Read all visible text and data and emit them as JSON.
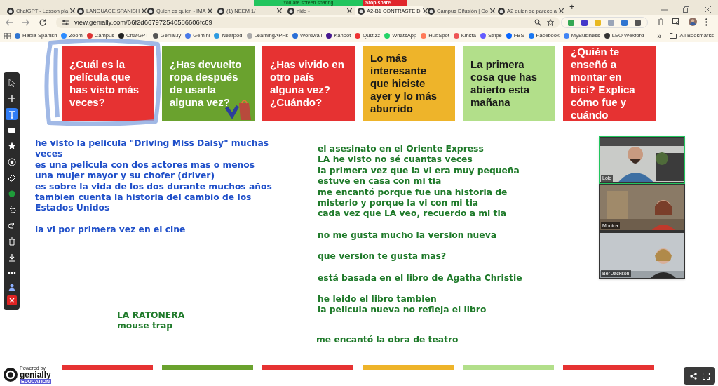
{
  "browser": {
    "tabs": [
      {
        "label": "ChatGPT - Lesson pla",
        "selected": false
      },
      {
        "label": "LANGUAGE SPANISH",
        "selected": false
      },
      {
        "label": "Quien es quien - IMA",
        "selected": false
      },
      {
        "label": "(1) NEEM 1/",
        "selected": false
      },
      {
        "label": "nido -",
        "selected": false
      },
      {
        "label": "A2-B1 CONTRASTE D",
        "selected": true
      },
      {
        "label": "Campus Difusión | Co",
        "selected": false
      },
      {
        "label": "A2 quien se parece a",
        "selected": false
      }
    ],
    "new_tab": "+",
    "sharing_banner": {
      "text": "You are screen sharing",
      "stop": "Stop share"
    },
    "url": "view.genially.com/66f2d667972540586606fc69",
    "bookmarks": [
      "Habla Spanish",
      "Zoom",
      "Campus",
      "ChatGPT",
      "Genial.ly",
      "Gemini",
      "Nearpod",
      "LearningAPPs",
      "Wordwall",
      "Kahoot",
      "Quizizz",
      "WhatsApp",
      "HubSpot",
      "Kinsta",
      "Stripe",
      "FBS",
      "Facebook",
      "MyBusiness",
      "LEO Wexford"
    ],
    "more_bookmarks": "»",
    "all_bookmarks": "All Bookmarks"
  },
  "slide": {
    "cards": [
      {
        "text": "¿Cuál es la película que has visto más veces?",
        "color": "#e63232",
        "dark_text": false
      },
      {
        "text": "¿Has devuelto ropa después de usarla alguna vez?",
        "color": "#6aa22e",
        "dark_text": false
      },
      {
        "text": "¿Has vivido en otro país alguna vez? ¿Cuándo?",
        "color": "#e63232",
        "dark_text": false
      },
      {
        "text": "Lo más interesante que hiciste ayer y lo más aburrido",
        "color": "#eeb42a",
        "dark_text": true
      },
      {
        "text": "La primera cosa que has abierto esta mañana",
        "color": "#b2df8a",
        "dark_text": true
      },
      {
        "text": "¿Quién te enseñó a montar en bici? Explica cómo fue y cuándo",
        "color": "#e63232",
        "dark_text": false
      }
    ],
    "left_notes": [
      {
        "lines": [
          "he visto la pelicula \"Driving Miss Daisy\" muchas",
          "veces",
          "es una pelicula con dos actores mas o menos",
          "una mujer mayor y su chofer (driver)",
          "es sobre la vida de los dos durante muchos años",
          "tambien cuenta la historia del cambio de los",
          "Estados Unidos"
        ]
      },
      {
        "lines": [
          "la vi por primera vez en el cine"
        ]
      }
    ],
    "right_notes": [
      {
        "lines": [
          "el asesinato en el Oriente Express",
          "LA he visto no sé cuantas veces",
          "la primera vez que la vi era muy pequeña",
          "estuve en casa con mi tia",
          "me encantó porque fue una historia de",
          "misterio y porque la vi con mi tia",
          "cada vez que LA veo, recuerdo a mi tia"
        ]
      },
      {
        "lines": [
          "no me gusta mucho la version nueva"
        ]
      },
      {
        "lines": [
          "que version te gusta mas?"
        ]
      },
      {
        "lines": [
          "está basada en el libro de Agatha Christie"
        ]
      },
      {
        "lines": [
          "he leido el libro tambien",
          "la pelicula nueva no refleja el libro"
        ]
      }
    ],
    "ratonera": [
      "LA RATONERA",
      "mouse trap"
    ],
    "theatre": "me encantó la obra de teatro"
  },
  "toolbar": [
    {
      "selected": false
    },
    {
      "selected": false
    },
    {
      "selected": true
    },
    {
      "selected": false
    },
    {
      "selected": false
    },
    {
      "selected": false
    },
    {
      "selected": false
    },
    {
      "selected": false
    },
    {
      "selected": false
    },
    {
      "selected": false
    },
    {
      "selected": false
    },
    {
      "selected": false
    },
    {
      "selected": false
    }
  ],
  "video": [
    {
      "name": "Lolo",
      "speaking": true
    },
    {
      "name": "Monica",
      "speaking": false
    },
    {
      "name": "Ber Jackson",
      "speaking": false
    }
  ],
  "branding": {
    "powered": "Powered by",
    "name": "genially",
    "badge": "EDUCATION"
  }
}
